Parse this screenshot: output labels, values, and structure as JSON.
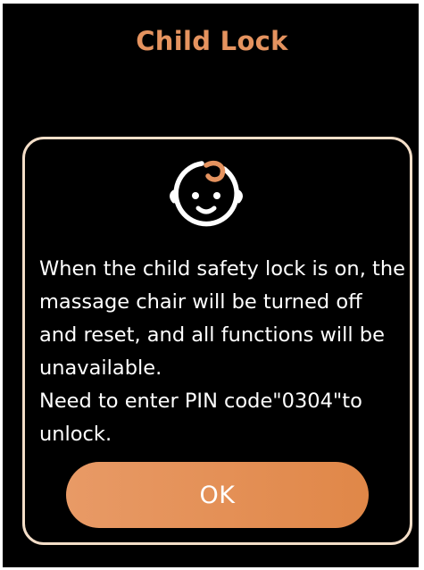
{
  "title": "Child Lock",
  "icon": "baby-face-icon",
  "message": {
    "line1": "When the child safety lock is on, the massage chair will be turned off and reset, and all functions will be unavailable.",
    "line2": "Need to enter PIN code\"0304\"to unlock."
  },
  "ok_label": "OK",
  "colors": {
    "accent": "#E5935F",
    "border": "#F4DEC8",
    "background": "#000000",
    "text": "#FFFFFF"
  }
}
